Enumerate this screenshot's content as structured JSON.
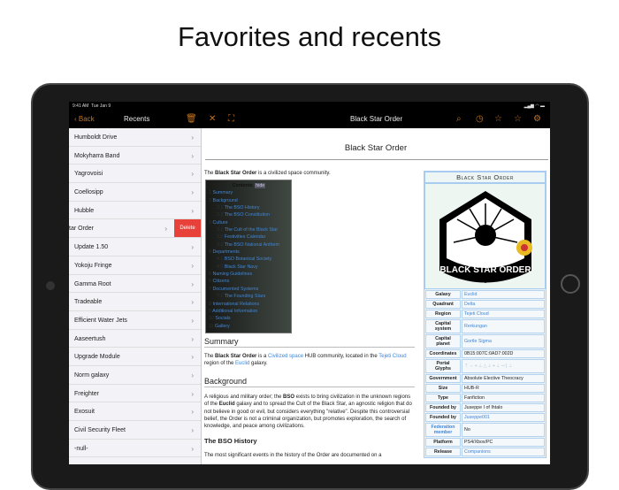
{
  "headline": "Favorites and recents",
  "status": {
    "time": "9:41 AM",
    "date": "Tue Jan 9"
  },
  "sidebar_nav": {
    "back": "Back",
    "title": "Recents"
  },
  "recents": [
    "Humboldt Drive",
    "Mokyharra Band",
    "Yagrovoisi",
    "Coellosipp",
    "Hubble",
    "tar Order",
    "Update 1.50",
    "Yokoju Fringe",
    "Gamma Root",
    "Tradeable",
    "Efficient Water Jets",
    "Aaseertush",
    "Upgrade Module",
    "Norm galaxy",
    "Freighter",
    "Exosuit",
    "Civil Security Fleet",
    "-null-"
  ],
  "delete_label": "Delete",
  "content_nav": {
    "title": "Black Star Order"
  },
  "article": {
    "title": "Black Star Order",
    "intro": {
      "pre": "The ",
      "bold": "Black Star Order",
      "post": " is a civilized space community."
    },
    "toc": {
      "title": "Contents",
      "hide": "hide",
      "items": [
        {
          "n": "1",
          "t": "Summary",
          "sub": false
        },
        {
          "n": "2",
          "t": "Background",
          "sub": false
        },
        {
          "n": "2.1",
          "t": "The BSO History",
          "sub": true
        },
        {
          "n": "2.2",
          "t": "The BSO Constitution",
          "sub": true
        },
        {
          "n": "3",
          "t": "Culture",
          "sub": false
        },
        {
          "n": "3.1",
          "t": "The Cult of the Black Star",
          "sub": true
        },
        {
          "n": "3.2",
          "t": "Festivities Calendar",
          "sub": true
        },
        {
          "n": "3.3",
          "t": "The BSO National Anthem",
          "sub": true
        },
        {
          "n": "4",
          "t": "Departments",
          "sub": false
        },
        {
          "n": "4.1",
          "t": "BSO Botanical Society",
          "sub": true
        },
        {
          "n": "4.2",
          "t": "Black Star Navy",
          "sub": true
        },
        {
          "n": "5",
          "t": "Naming Guidelines",
          "sub": false
        },
        {
          "n": "6",
          "t": "Citizens",
          "sub": false
        },
        {
          "n": "7",
          "t": "Documented Systems",
          "sub": false
        },
        {
          "n": "7.1",
          "t": "The Founding Stars",
          "sub": true
        },
        {
          "n": "8",
          "t": "International Relations",
          "sub": false
        },
        {
          "n": "9",
          "t": "Additional Information",
          "sub": false
        },
        {
          "n": "10",
          "t": "Socials",
          "sub": false
        },
        {
          "n": "11",
          "t": "Gallery",
          "sub": false
        }
      ]
    },
    "summary": {
      "heading": "Summary",
      "p1": "The ",
      "b": "Black Star Order",
      "p2": " is a ",
      "l1": "Civilized space",
      "p3": " HUB community, located in the ",
      "l2": "Tejeti Cloud",
      "p4": " region of the ",
      "l3": "Euclid",
      "p5": " galaxy."
    },
    "background": {
      "heading": "Background",
      "p1": "A religious and military order; the ",
      "b1": "BSO",
      "p2": " exists to bring civilization in the unknown regions of the ",
      "b2": "Euclid",
      "p3": " galaxy and to spread the Cult of the Black Star, an agnostic religion that do not believe in good or evil, but considers everything \"relative\". Despite this controversial belief, the Order is not a criminal organization, but promotes exploration, the search of knowledge, and peace among civilizations."
    },
    "history": {
      "heading": "The BSO History",
      "p": "The most significant events in the history of the Order are documented on a"
    }
  },
  "infobox": {
    "title": "Black Star Order",
    "logo_text": "BLACK STAR ORDER",
    "rows": [
      {
        "k": "Galaxy",
        "v": "Euclid",
        "link": true
      },
      {
        "k": "Quadrant",
        "v": "Delta",
        "link": true
      },
      {
        "k": "Region",
        "v": "Tejeti Cloud",
        "link": true
      },
      {
        "k": "Capital system",
        "v": "Rerkungan",
        "link": true
      },
      {
        "k": "Capital planet",
        "v": "Gortle Sigma",
        "link": true
      },
      {
        "k": "Coordinates",
        "v": "0B15:007C:0AD7:002D",
        "link": false
      },
      {
        "k": "Portal Glyphs",
        "v": "⇡⇔⌖⊥△⇣⌖⇣⊸⌊⊥",
        "link": false
      },
      {
        "k": "Government",
        "v": "Absolute Elective Theocracy",
        "link": false
      },
      {
        "k": "Size",
        "v": "HUB-R",
        "link": false
      },
      {
        "k": "Type",
        "v": "Fanfiction",
        "link": false
      },
      {
        "k": "Founded by",
        "v": "Juseppe I of Ihtalo",
        "link": false
      },
      {
        "k": "Founded by",
        "v": "Juseppe001",
        "link": true
      },
      {
        "k": "Federation member",
        "v": "No",
        "link": false
      },
      {
        "k": "Platform",
        "v": "PS4/Xbox/PC",
        "link": false
      },
      {
        "k": "Release",
        "v": "Companions",
        "link": true
      }
    ]
  },
  "colors": {
    "accent": "#c7731e",
    "link": "#3f86d6",
    "delete": "#e8413a"
  }
}
